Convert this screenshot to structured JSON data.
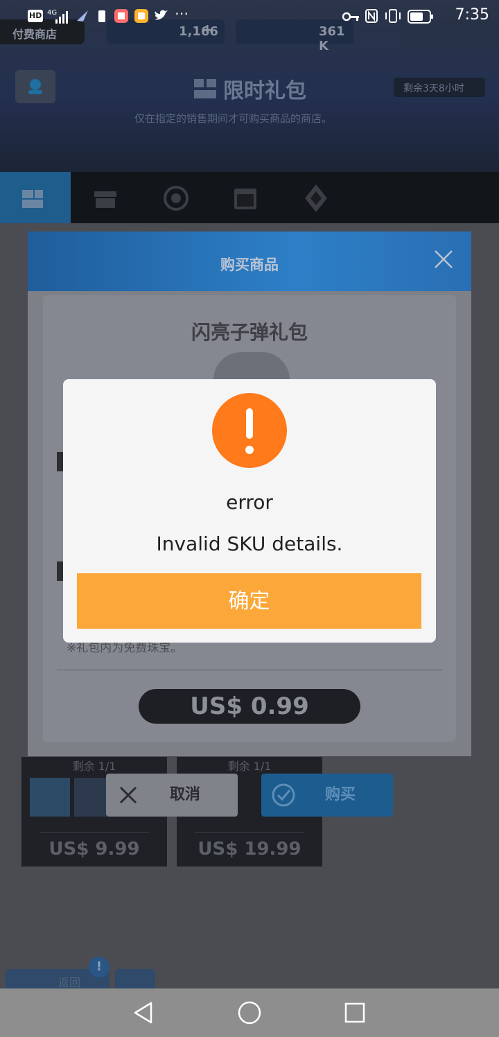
{
  "status_bar": {
    "network_label": "HD",
    "signal_label": "4G",
    "time": "7:35"
  },
  "game": {
    "shop_tab_label": "付费商店",
    "currency_1": "1,166",
    "currency_2": "361 K",
    "section_title": "限时礼包",
    "section_subtitle": "仅在指定的销售期间才可购买商品的商店。",
    "remaining_time": "剩余3天8小时"
  },
  "purchase_dialog": {
    "title": "购买商品",
    "item_name": "闪亮子弹礼包",
    "note": "※礼包内为免费珠宝。",
    "price": "US$ 0.99",
    "cancel_label": "取消",
    "buy_label": "购买"
  },
  "shop_cards": [
    {
      "remain": "剩余 1/1",
      "price": "US$ 9.99"
    },
    {
      "remain": "剩余 1/1",
      "price": "US$ 19.99"
    }
  ],
  "bottom_menu": {
    "back_label": "返回"
  },
  "error_dialog": {
    "icon": "exclamation-icon",
    "title": "error",
    "message": "Invalid SKU details.",
    "confirm_label": "确定"
  },
  "colors": {
    "alert_orange": "#ff7a1a",
    "confirm_orange": "#fba739"
  }
}
